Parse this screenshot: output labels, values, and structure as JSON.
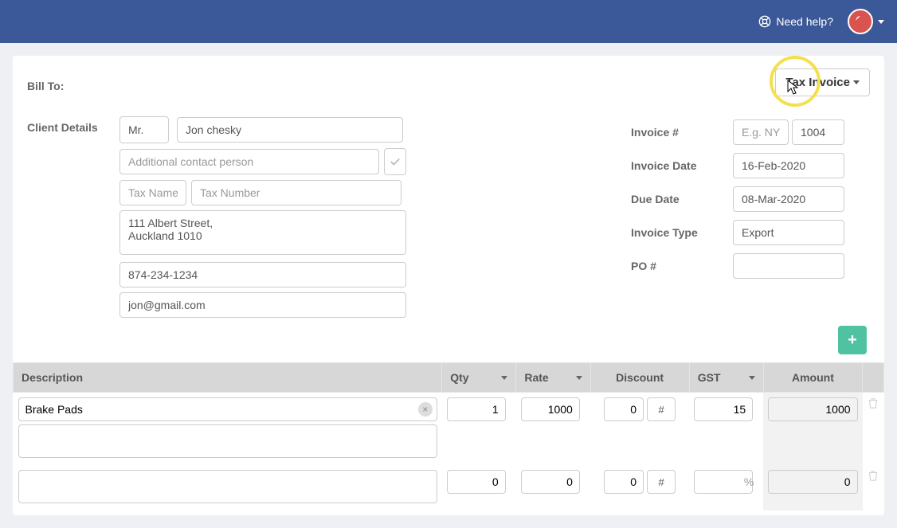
{
  "header": {
    "help_label": "Need help?"
  },
  "bill_to_label": "Bill To:",
  "client_details_label": "Client Details",
  "client": {
    "title": "Mr.",
    "name": "Jon chesky",
    "additional_placeholder": "Additional contact person",
    "tax_name_placeholder": "Tax Name",
    "tax_number_placeholder": "Tax Number",
    "address": "111 Albert Street,\nAuckland 1010",
    "phone": "874-234-1234",
    "email": "jon@gmail.com"
  },
  "doc_type_label": "Tax Invoice",
  "invoice_meta": {
    "invoice_num_label": "Invoice #",
    "invoice_prefix_placeholder": "E.g. NYC",
    "invoice_number": "1004",
    "invoice_date_label": "Invoice Date",
    "invoice_date": "16-Feb-2020",
    "due_date_label": "Due Date",
    "due_date": "08-Mar-2020",
    "invoice_type_label": "Invoice Type",
    "invoice_type": "Export",
    "po_label": "PO #",
    "po_value": ""
  },
  "table": {
    "headers": {
      "description": "Description",
      "qty": "Qty",
      "rate": "Rate",
      "discount": "Discount",
      "gst": "GST",
      "amount": "Amount"
    },
    "rows": [
      {
        "desc": "Brake Pads",
        "qty": "1",
        "rate": "1000",
        "discount": "0",
        "disc_type": "#",
        "gst": "15",
        "gst_suffix": "",
        "amount": "1000"
      },
      {
        "desc": "",
        "qty": "0",
        "rate": "0",
        "discount": "0",
        "disc_type": "#",
        "gst": "",
        "gst_suffix": "%",
        "amount": "0"
      }
    ]
  }
}
